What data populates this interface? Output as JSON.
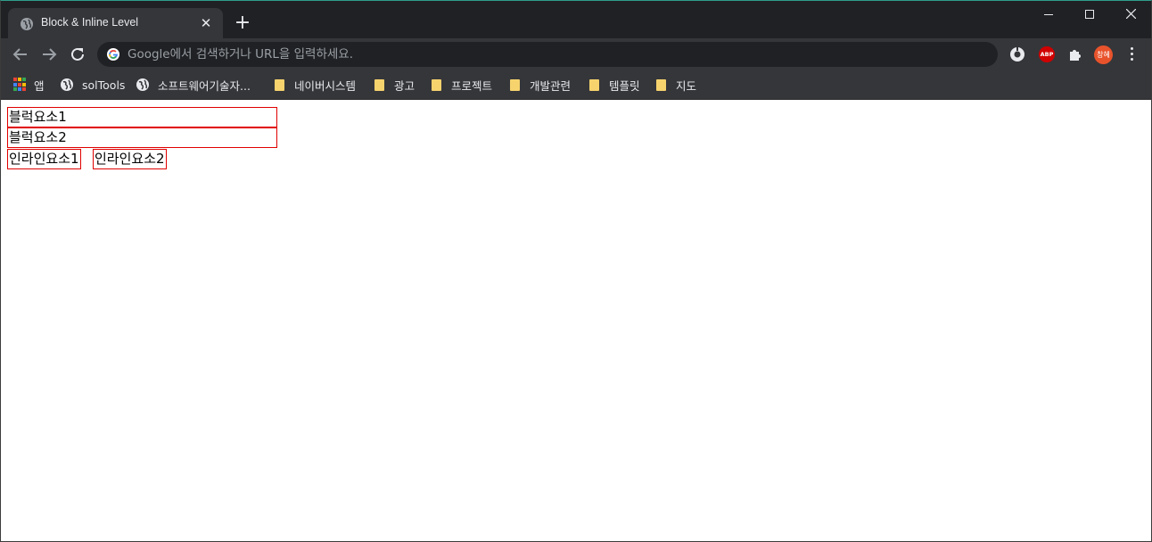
{
  "browser": {
    "tab": {
      "title": "Block & Inline Level"
    },
    "omnibox": {
      "placeholder": "Google에서 검색하거나 URL을 입력하세요."
    },
    "profile_label": "창혜",
    "abp_label": "ABP",
    "colors": {
      "tabstrip": "#202124",
      "toolbar": "#35363a",
      "profile": "#e8532b",
      "abp": "#d00000",
      "folder": "#f6d36d"
    }
  },
  "bookmarks": [
    {
      "label": "앱",
      "icon": "apps-icon"
    },
    {
      "label": "solTools",
      "icon": "globe-icon"
    },
    {
      "label": "소프트웨어기술자...",
      "icon": "globe-icon"
    },
    {
      "label": "네이버시스템",
      "icon": "folder-icon"
    },
    {
      "label": "광고",
      "icon": "folder-icon"
    },
    {
      "label": "프로젝트",
      "icon": "folder-icon"
    },
    {
      "label": "개발관련",
      "icon": "folder-icon"
    },
    {
      "label": "템플릿",
      "icon": "folder-icon"
    },
    {
      "label": "지도",
      "icon": "folder-icon"
    }
  ],
  "page": {
    "blocks": [
      "블럭요소1",
      "블럭요소2"
    ],
    "inlines": [
      "인라인요소1",
      "인라인요소2"
    ],
    "border_color": "#e00000"
  }
}
